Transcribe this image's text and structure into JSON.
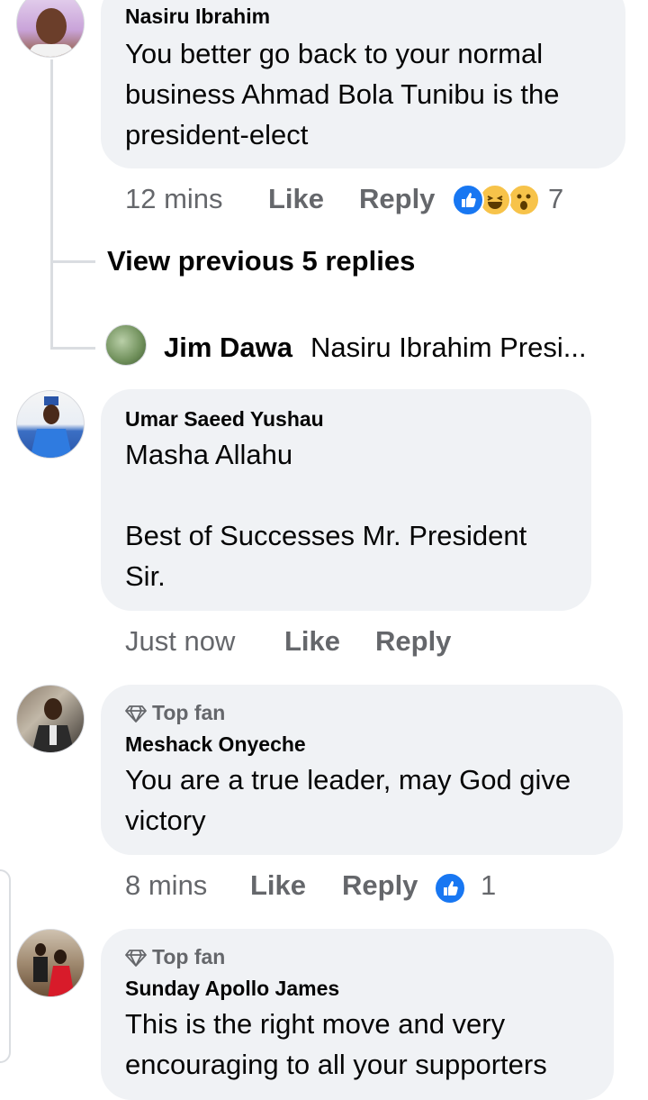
{
  "top_comment": {
    "author": "Nasiru Ibrahim",
    "text": "You better go back to your  normal business Ahmad Bola Tunibu is the president-elect",
    "time": "12 mins",
    "like_label": "Like",
    "reply_label": "Reply",
    "reaction_count": "7",
    "reactions": [
      "like-icon",
      "laugh-icon",
      "wow-icon"
    ]
  },
  "replies_link": {
    "label": "View previous 5 replies"
  },
  "collapsed_reply": {
    "author": "Jim Dawa",
    "preview": "Nasiru Ibrahim Presi..."
  },
  "comments": [
    {
      "author": "Umar Saeed Yushau",
      "line1": "Masha Allahu",
      "line2": "Best of Successes Mr. President",
      "line3": "Sir.",
      "time": "Just now",
      "like_label": "Like",
      "reply_label": "Reply"
    },
    {
      "badge": "Top fan",
      "author": "Meshack Onyeche",
      "line1": "You are a true leader, may God give",
      "line2": "victory",
      "time": "8 mins",
      "like_label": "Like",
      "reply_label": "Reply",
      "reaction_count": "1"
    },
    {
      "badge": "Top fan",
      "author": "Sunday Apollo James",
      "line1": "This is the right move and very",
      "line2": "encouraging to all your supporters"
    }
  ],
  "colors": {
    "bubble": "#f0f2f5",
    "meta": "#65676b",
    "like_blue": "#1877f2",
    "haha_yellow": "#f7c34a"
  }
}
